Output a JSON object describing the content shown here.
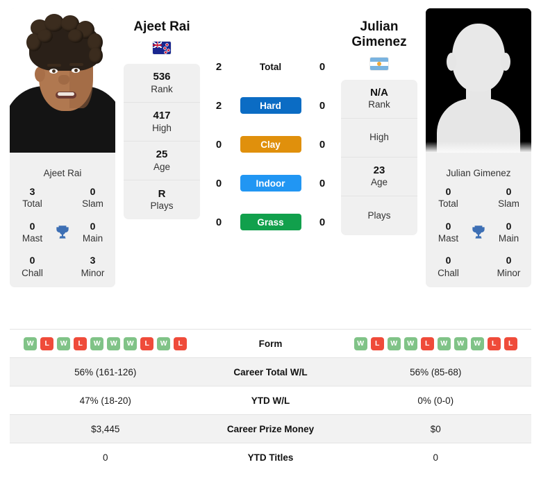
{
  "players": {
    "left": {
      "name": "Ajeet Rai",
      "photo_caption": "Ajeet Rai",
      "flag": "nz-flag-icon",
      "flag_name": "New Zealand",
      "stats": [
        {
          "value": "536",
          "label": "Rank"
        },
        {
          "value": "417",
          "label": "High"
        },
        {
          "value": "25",
          "label": "Age"
        },
        {
          "value": "R",
          "label": "Plays"
        }
      ],
      "titles": {
        "card_name": "Ajeet Rai",
        "total": "3",
        "total_label": "Total",
        "slam": "0",
        "slam_label": "Slam",
        "mast": "0",
        "mast_label": "Mast",
        "main": "0",
        "main_label": "Main",
        "chall": "0",
        "chall_label": "Chall",
        "minor": "3",
        "minor_label": "Minor"
      },
      "form": [
        "W",
        "L",
        "W",
        "L",
        "W",
        "W",
        "W",
        "L",
        "W",
        "L"
      ],
      "career_total_wl": "56% (161-126)",
      "ytd_wl": "47% (18-20)",
      "career_prize_money": "$3,445",
      "ytd_titles": "0"
    },
    "right": {
      "name": "Julian Gimenez",
      "photo_caption": "Julian Gimenez",
      "flag": "ar-flag-icon",
      "flag_name": "Argentina",
      "stats": [
        {
          "value": "N/A",
          "label": "Rank"
        },
        {
          "value": "",
          "label": "High"
        },
        {
          "value": "23",
          "label": "Age"
        },
        {
          "value": "",
          "label": "Plays"
        }
      ],
      "titles": {
        "card_name": "Julian Gimenez",
        "total": "0",
        "total_label": "Total",
        "slam": "0",
        "slam_label": "Slam",
        "mast": "0",
        "mast_label": "Mast",
        "main": "0",
        "main_label": "Main",
        "chall": "0",
        "chall_label": "Chall",
        "minor": "0",
        "minor_label": "Minor"
      },
      "form": [
        "W",
        "L",
        "W",
        "W",
        "L",
        "W",
        "W",
        "W",
        "L",
        "L"
      ],
      "career_total_wl": "56% (85-68)",
      "ytd_wl": "0% (0-0)",
      "career_prize_money": "$0",
      "ytd_titles": "0"
    }
  },
  "head_to_head": [
    {
      "label": "Total",
      "left": "2",
      "right": "0",
      "style": "plain",
      "color": ""
    },
    {
      "label": "Hard",
      "left": "2",
      "right": "0",
      "style": "pill",
      "color": "#0b6cc4"
    },
    {
      "label": "Clay",
      "left": "0",
      "right": "0",
      "style": "pill",
      "color": "#e0900c"
    },
    {
      "label": "Indoor",
      "left": "0",
      "right": "0",
      "style": "pill",
      "color": "#2196f3"
    },
    {
      "label": "Grass",
      "left": "0",
      "right": "0",
      "style": "pill",
      "color": "#11a04c"
    }
  ],
  "comparison_table": [
    {
      "label": "Form",
      "key": "form",
      "type": "form"
    },
    {
      "label": "Career Total W/L",
      "key": "career_total_wl",
      "type": "text"
    },
    {
      "label": "YTD W/L",
      "key": "ytd_wl",
      "type": "text"
    },
    {
      "label": "Career Prize Money",
      "key": "career_prize_money",
      "type": "text"
    },
    {
      "label": "YTD Titles",
      "key": "ytd_titles",
      "type": "text"
    }
  ],
  "colors": {
    "hard": "#0b6cc4",
    "clay": "#e0900c",
    "indoor": "#2196f3",
    "grass": "#11a04c",
    "win": "#80c387",
    "loss": "#ef4b3a",
    "trophy": "#3d6fb4",
    "card_bg": "#f0f0f0",
    "row_alt": "#f2f2f2"
  }
}
